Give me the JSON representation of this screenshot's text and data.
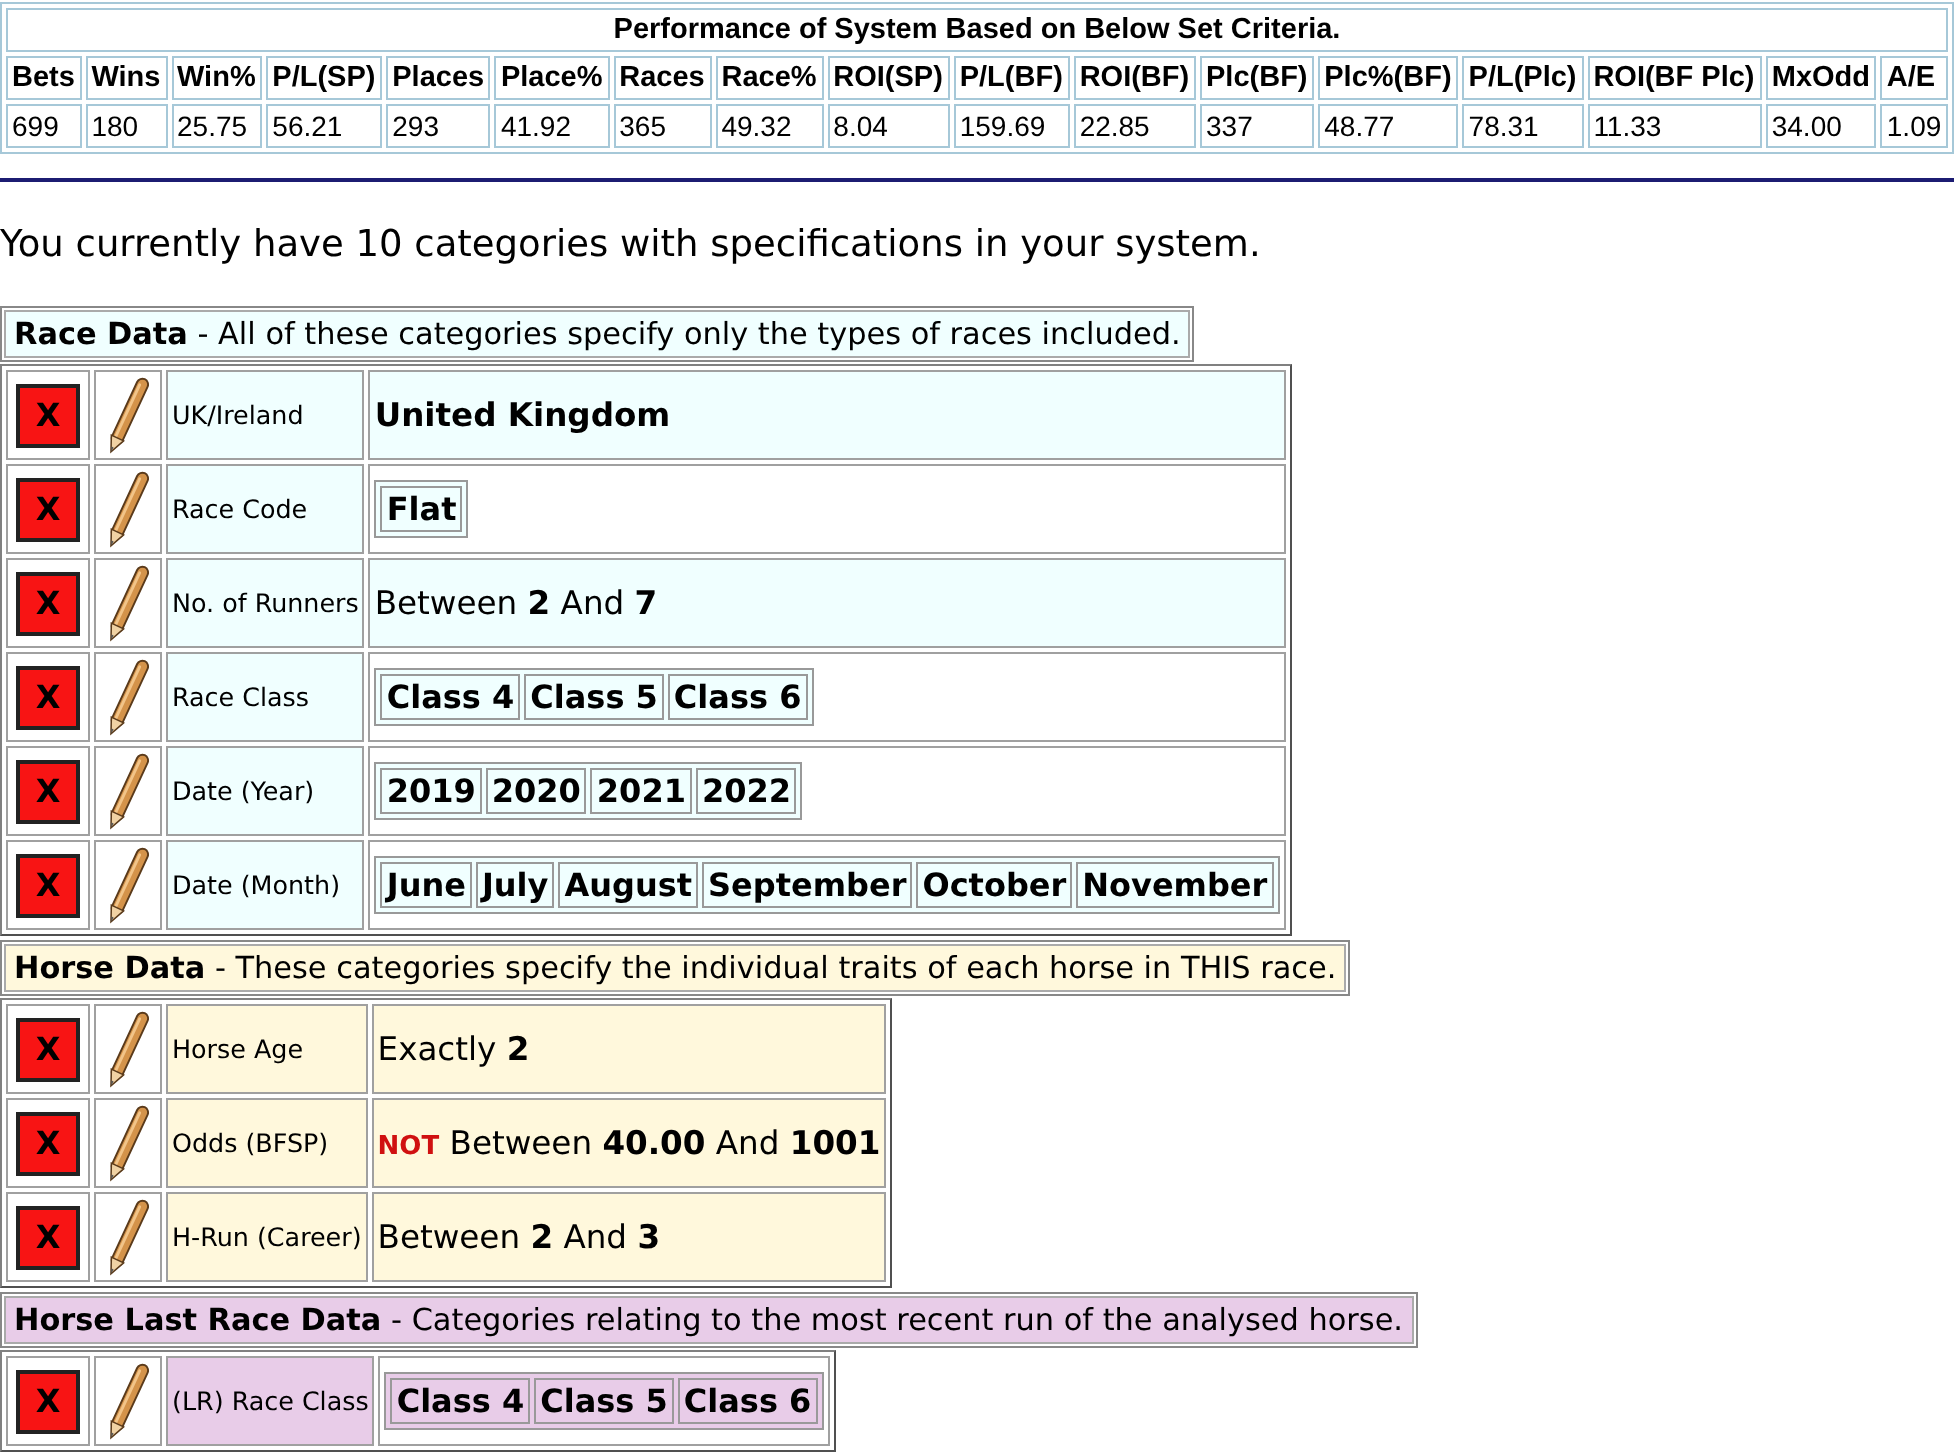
{
  "performance": {
    "title": "Performance of System Based on Below Set Criteria.",
    "columns": [
      "Bets",
      "Wins",
      "Win%",
      "P/L(SP)",
      "Places",
      "Place%",
      "Races",
      "Race%",
      "ROI(SP)",
      "P/L(BF)",
      "ROI(BF)",
      "Plc(BF)",
      "Plc%(BF)",
      "P/L(Plc)",
      "ROI(BF Plc)",
      "MxOdd",
      "A/E"
    ],
    "rows": [
      [
        "699",
        "180",
        "25.75",
        "56.21",
        "293",
        "41.92",
        "365",
        "49.32",
        "8.04",
        "159.69",
        "22.85",
        "337",
        "48.77",
        "78.31",
        "11.33",
        "34.00",
        "1.09"
      ]
    ]
  },
  "summary": "You currently have 10 categories with specifications in your system.",
  "sections": [
    {
      "header": "**Race Data** - All of these categories specify only the types of races included.",
      "color": "#f0ffff",
      "categories": [
        {
          "delete_label": "X",
          "label": "UK/Ireland",
          "kind": "single",
          "value": "United Kingdom"
        },
        {
          "delete_label": "X",
          "label": "Race Code",
          "kind": "chips",
          "values": [
            "Flat"
          ]
        },
        {
          "delete_label": "X",
          "label": "No. of Runners",
          "kind": "range",
          "value": "Between **2** And **7**"
        },
        {
          "delete_label": "X",
          "label": "Race Class",
          "kind": "chips",
          "values": [
            "Class 4",
            "Class 5",
            "Class 6"
          ]
        },
        {
          "delete_label": "X",
          "label": "Date (Year)",
          "kind": "chips",
          "values": [
            "2019",
            "2020",
            "2021",
            "2022"
          ]
        },
        {
          "delete_label": "X",
          "label": "Date (Month)",
          "kind": "chips",
          "values": [
            "June",
            "July",
            "August",
            "September",
            "October",
            "November"
          ]
        }
      ]
    },
    {
      "header": "**Horse Data** - These categories specify the individual traits of each horse in THIS race.",
      "color": "#fff8dc",
      "categories": [
        {
          "delete_label": "X",
          "label": "Horse Age",
          "kind": "range",
          "value": "Exactly **2**"
        },
        {
          "delete_label": "X",
          "label": "Odds (BFSP)",
          "kind": "range",
          "negation": "NOT",
          "value": "Between **40.00** And **1001**"
        },
        {
          "delete_label": "X",
          "label": "H-Run (Career)",
          "kind": "range",
          "value": "Between **2** And **3**"
        }
      ]
    },
    {
      "header": "**Horse Last Race Data** - Categories relating to the most recent run of the analysed horse.",
      "color": "#e8cce8",
      "categories": [
        {
          "delete_label": "X",
          "label": "(LR) Race Class",
          "kind": "chips",
          "values": [
            "Class 4",
            "Class 5",
            "Class 6"
          ]
        }
      ]
    }
  ]
}
